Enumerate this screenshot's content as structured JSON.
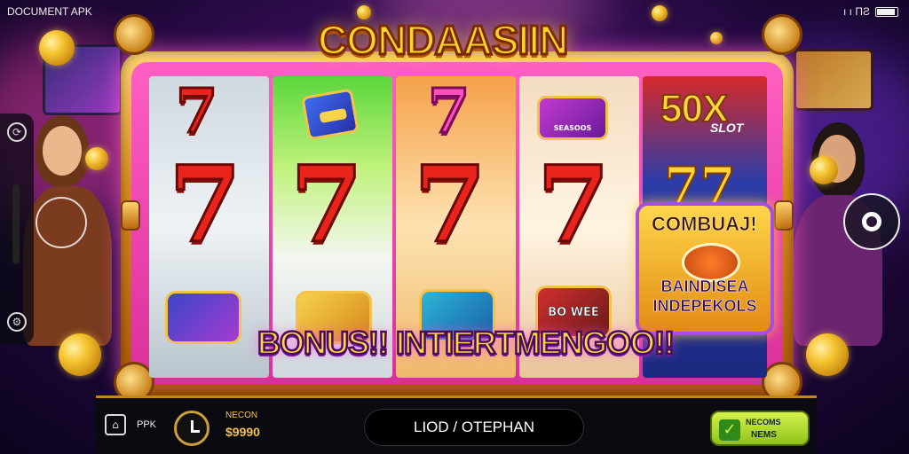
{
  "status_bar": {
    "app_label": "DOCUMENT APK",
    "signal_text": "ı ı ΠƧ",
    "battery_icon": "battery-icon"
  },
  "game": {
    "title": "CONDAASIIN",
    "multiplier_text": "50X",
    "multiplier_sub": "SLOT",
    "reel5_symbol": "77",
    "bonus_card_title": "COMBUAJ!",
    "bonus_card_sub_line1": "BAINDISEA",
    "bonus_card_sub_line2": "INDEPEKOLS",
    "banner": "BONUS!! INTIERTMENGOO!!",
    "symbol_badge_label": "SEASOOS",
    "bottom_symbol_label": "BO WEE"
  },
  "side_controls": {
    "top_icon": "refresh-icon",
    "bottom_icon": "settings-icon"
  },
  "bottom_panel": {
    "icon_label": "PPK",
    "stat_label": "NECON",
    "stat_value": "$9990",
    "field_text": "LIOD / OTEPHAN",
    "action_line1": "NECOMS",
    "action_line2": "NEMS"
  },
  "colors": {
    "accent_gold": "#ffd32a",
    "frame_pink": "#ff5fc3",
    "seven_red": "#e8241c",
    "action_green": "#8ec21c"
  }
}
